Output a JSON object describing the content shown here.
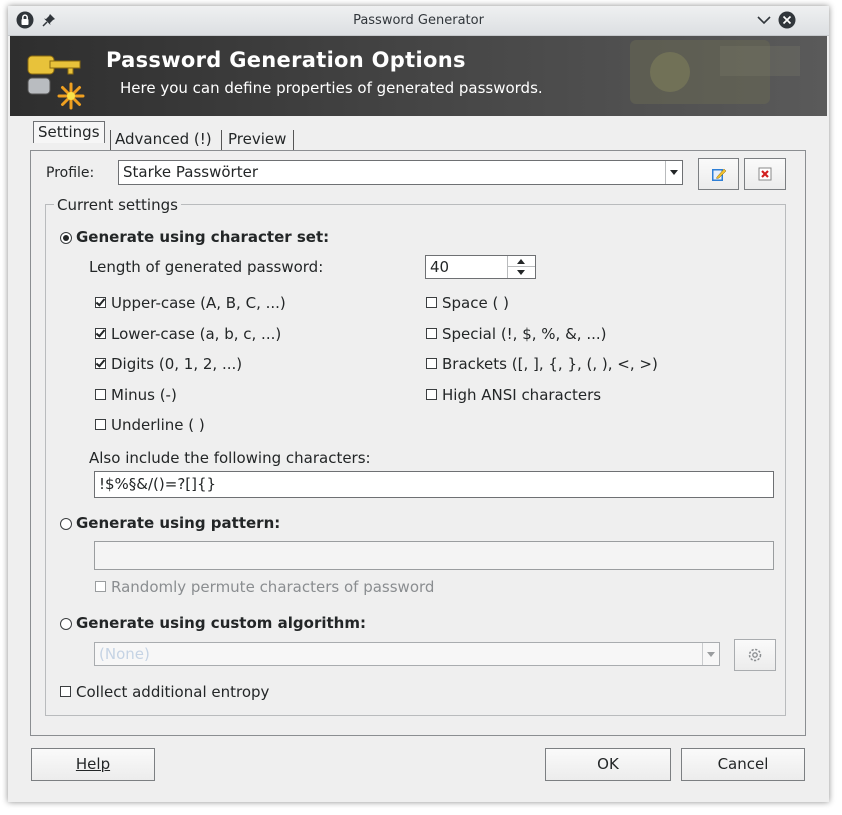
{
  "window": {
    "title": "Password Generator"
  },
  "banner": {
    "title": "Password Generation Options",
    "subtitle": "Here you can define properties of generated passwords."
  },
  "tabs": [
    {
      "label": "Settings",
      "active": true
    },
    {
      "label": "Advanced (!)",
      "active": false
    },
    {
      "label": "Preview",
      "active": false
    }
  ],
  "profile": {
    "label": "Profile:",
    "value": "Starke Passwörter"
  },
  "current_settings": {
    "title": "Current settings"
  },
  "charset": {
    "radio_label": "Generate using character set:",
    "length_label": "Length of generated password:",
    "length_value": "40",
    "options": {
      "upper": {
        "label": "Upper-case (A, B, C, ...)",
        "checked": true
      },
      "lower": {
        "label": "Lower-case (a, b, c, ...)",
        "checked": true
      },
      "digits": {
        "label": "Digits (0, 1, 2, ...)",
        "checked": true
      },
      "minus": {
        "label": "Minus (-)",
        "checked": false
      },
      "underline": {
        "label": "Underline ( )",
        "checked": false
      },
      "space": {
        "label": "Space ( )",
        "checked": false
      },
      "special": {
        "label": "Special (!, $, %, &, ...)",
        "checked": false
      },
      "brackets": {
        "label": "Brackets ([, ], {, }, (, ), <, >)",
        "checked": false
      },
      "high_ansi": {
        "label": "High ANSI characters",
        "checked": false
      }
    },
    "also_include_label": "Also include the following characters:",
    "also_include_value": "!$%§&/()=?[]{}"
  },
  "pattern": {
    "radio_label": "Generate using pattern:",
    "value": "",
    "permute_label": "Randomly permute characters of password"
  },
  "custom": {
    "radio_label": "Generate using custom algorithm:",
    "selected": "(None)"
  },
  "entropy_label": "Collect additional entropy",
  "buttons": {
    "help": "Help",
    "ok": "OK",
    "cancel": "Cancel"
  }
}
